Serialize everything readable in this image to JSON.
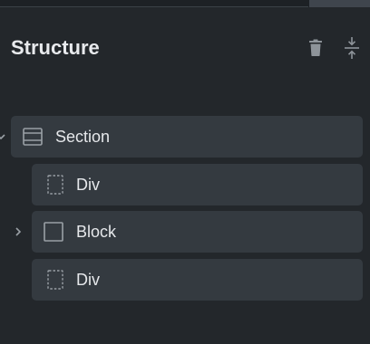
{
  "panel": {
    "title": "Structure",
    "icons": {
      "delete": "trash-icon",
      "collapse_all": "collapse-vertical-icon"
    }
  },
  "tree": [
    {
      "label": "Section",
      "icon": "section-icon",
      "expanded": true,
      "depth": 0
    },
    {
      "label": "Div",
      "icon": "div-icon",
      "depth": 1
    },
    {
      "label": "Block",
      "icon": "block-icon",
      "expanded": false,
      "depth": 1
    },
    {
      "label": "Div",
      "icon": "div-icon",
      "depth": 1
    }
  ],
  "colors": {
    "background": "#23272b",
    "row_background": "#343a40",
    "text": "#e6e8eb",
    "icon": "#9aa0a6"
  }
}
